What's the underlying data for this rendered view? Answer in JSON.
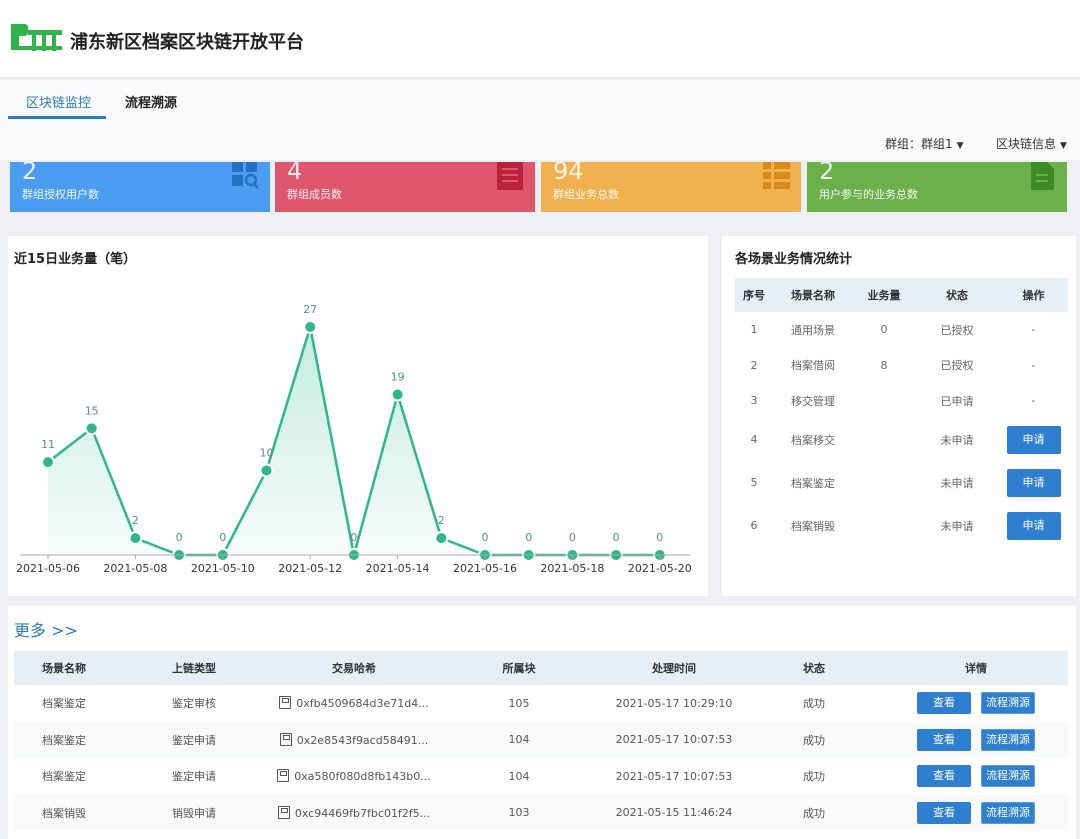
{
  "header": {
    "title": "浦东新区档案区块链开放平台"
  },
  "tabs": [
    {
      "label": "区块链监控"
    },
    {
      "label": "流程溯源"
    }
  ],
  "toolbar": {
    "group_label": "群组：群组1",
    "chain_info_label": "区块链信息"
  },
  "stats": [
    {
      "value": "2",
      "label": "群组授权用户数",
      "color": "#4a9df2",
      "icon": "grid-search-icon"
    },
    {
      "value": "4",
      "label": "群组成员数",
      "color": "#e0566c",
      "icon": "document-icon"
    },
    {
      "value": "94",
      "label": "群组业务总数",
      "color": "#f0b14e",
      "icon": "list-icon"
    },
    {
      "value": "2",
      "label": "用户参与的业务总数",
      "color": "#6cb04c",
      "icon": "file-icon"
    }
  ],
  "chart_panel": {
    "title": "近15日业务量（笔）"
  },
  "chart_data": {
    "type": "area",
    "title": "近15日业务量（笔）",
    "x": [
      "2021-05-06",
      "2021-05-07",
      "2021-05-08",
      "2021-05-09",
      "2021-05-10",
      "2021-05-11",
      "2021-05-12",
      "2021-05-13",
      "2021-05-14",
      "2021-05-15",
      "2021-05-16",
      "2021-05-17",
      "2021-05-18",
      "2021-05-19",
      "2021-05-20"
    ],
    "x_tick_labels": [
      "2021-05-06",
      "2021-05-08",
      "2021-05-10",
      "2021-05-12",
      "2021-05-14",
      "2021-05-16",
      "2021-05-18",
      "2021-05-20"
    ],
    "values": [
      11,
      15,
      2,
      0,
      0,
      10,
      27,
      0,
      19,
      2,
      0,
      0,
      0,
      0,
      0
    ],
    "ylim": [
      0,
      27
    ],
    "color": "#2db88a",
    "grid": false
  },
  "scene_panel": {
    "title": "各场景业务情况统计",
    "headers": [
      "序号",
      "场景名称",
      "业务量",
      "状态",
      "操作"
    ],
    "rows": [
      {
        "no": "1",
        "name": "通用场景",
        "count": "0",
        "status": "已授权",
        "status_type": "ok",
        "action": "-"
      },
      {
        "no": "2",
        "name": "档案借阅",
        "count": "8",
        "status": "已授权",
        "status_type": "ok",
        "action": "-"
      },
      {
        "no": "3",
        "name": "移交管理",
        "count": "",
        "status": "已申请",
        "status_type": "pending",
        "action": "-"
      },
      {
        "no": "4",
        "name": "档案移交",
        "count": "",
        "status": "未申请",
        "status_type": "none",
        "action": "申请"
      },
      {
        "no": "5",
        "name": "档案鉴定",
        "count": "",
        "status": "未申请",
        "status_type": "none",
        "action": "申请"
      },
      {
        "no": "6",
        "name": "档案销毁",
        "count": "",
        "status": "未申请",
        "status_type": "none",
        "action": "申请"
      }
    ]
  },
  "more_link": "更多 >>",
  "tx_table": {
    "headers": [
      "场景名称",
      "上链类型",
      "交易哈希",
      "所属块",
      "处理时间",
      "状态",
      "详情"
    ],
    "rows": [
      {
        "scene": "档案鉴定",
        "type": "鉴定审核",
        "hash": "0xfb4509684d3e71d4...",
        "block": "105",
        "time": "2021-05-17 10:29:10",
        "status": "成功"
      },
      {
        "scene": "档案鉴定",
        "type": "鉴定申请",
        "hash": "0x2e8543f9acd58491...",
        "block": "104",
        "time": "2021-05-17 10:07:53",
        "status": "成功"
      },
      {
        "scene": "档案鉴定",
        "type": "鉴定申请",
        "hash": "0xa580f080d8fb143b0...",
        "block": "104",
        "time": "2021-05-17 10:07:53",
        "status": "成功"
      },
      {
        "scene": "档案销毁",
        "type": "销毁申请",
        "hash": "0xc94469fb7fbc01f2f5...",
        "block": "103",
        "time": "2021-05-15 11:46:24",
        "status": "成功"
      }
    ],
    "view_label": "查看",
    "trace_label": "流程溯源"
  }
}
